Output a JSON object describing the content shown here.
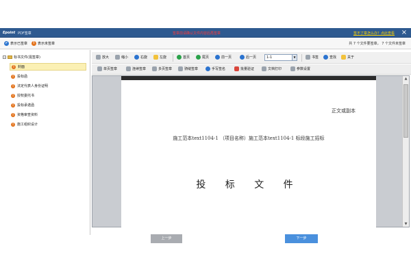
{
  "titlebar": {
    "brand": "Epoint",
    "app_title": "PDF签章",
    "warning": "签章前请确认文件内容后再签章",
    "help_link": "签不了章怎么办？点此查看",
    "close": "×"
  },
  "status": {
    "signed_label": "表示已签章",
    "unsigned_label": "表示未签章",
    "signed_count": "共 7 个文件要签章",
    "unsigned_count": "7 个文件未签章"
  },
  "sidebar": {
    "root": "标书文件(需签章)",
    "items": [
      {
        "label": "封面",
        "selected": true
      },
      {
        "label": "投标函",
        "selected": false
      },
      {
        "label": "法定代表人身份证明",
        "selected": false
      },
      {
        "label": "授权委托书",
        "selected": false
      },
      {
        "label": "投标承诺函",
        "selected": false
      },
      {
        "label": "资格审查资料",
        "selected": false
      },
      {
        "label": "施工组织设计",
        "selected": false
      }
    ]
  },
  "toolbar1": {
    "zoom_in": "放大",
    "zoom_out": "缩小",
    "rotate_right": "右旋",
    "rotate_left": "左旋",
    "first_page": "首页",
    "last_page": "尾页",
    "prev_page": "前一页",
    "next_page": "后一页",
    "page_value": "1-1",
    "bookmark": "书签",
    "find": "查找",
    "about": "关于"
  },
  "toolbar2": {
    "single_sign": "单页签章",
    "batch_sign": "连续签章",
    "multi_sign": "多页签章",
    "ride_seam": "骑缝签章",
    "handwrite": "手写签名",
    "verify": "批量验证",
    "print": "文档打印",
    "settings": "参数设置"
  },
  "document": {
    "copy_label": "正文或副本",
    "heading": "施工范本text1104-1 （项目名称）施工范本text1104-1 标段施工招标",
    "title": "投 标 文 件"
  },
  "scrollbar": {
    "up": "▲",
    "down": "▼"
  },
  "footer": {
    "prev_button": "上一步",
    "next_button": "下一步"
  },
  "icons": {
    "signed_dot": "✔",
    "unsigned_dot": "!",
    "page_dropdown": "▼"
  }
}
